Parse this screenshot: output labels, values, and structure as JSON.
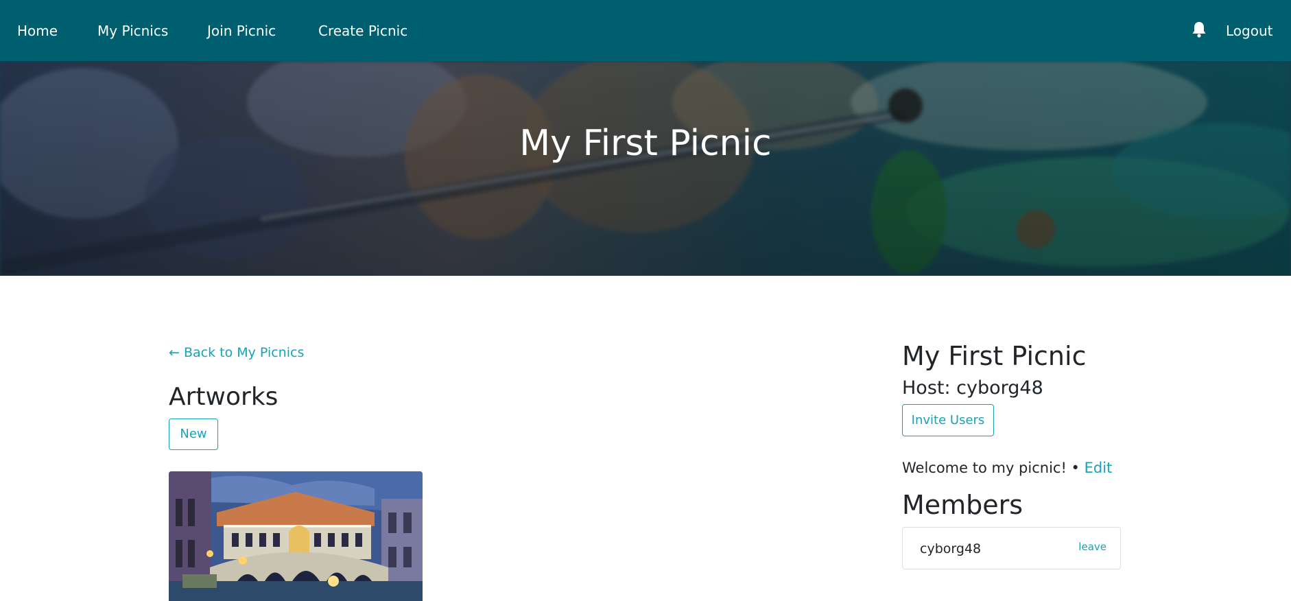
{
  "nav": {
    "items": [
      {
        "label": "Home"
      },
      {
        "label": "My Picnics"
      },
      {
        "label": "Join Picnic"
      },
      {
        "label": "Create Picnic"
      }
    ],
    "notifications_icon": "bell-icon",
    "logout_label": "Logout"
  },
  "hero": {
    "title": "My First Picnic"
  },
  "main": {
    "back_link": "← Back to My Picnics",
    "artworks_heading": "Artworks",
    "new_button": "New"
  },
  "sidebar": {
    "picnic_title": "My First Picnic",
    "host_line": "Host: cyborg48",
    "invite_button": "Invite Users",
    "description": "Welcome to my picnic! • ",
    "edit_link": "Edit",
    "members_heading": "Members",
    "members": [
      {
        "name": "cyborg48",
        "action": "leave"
      }
    ]
  },
  "colors": {
    "navbar": "#005f6e",
    "accent": "#17a2b8",
    "text": "#212529"
  }
}
